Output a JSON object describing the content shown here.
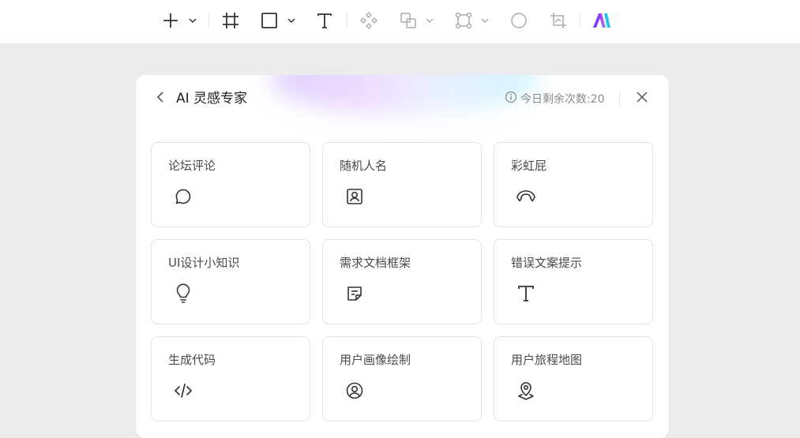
{
  "toolbar": {
    "icons": [
      "plus-icon",
      "chevron-down-icon",
      "frame-icon",
      "rectangle-icon",
      "chevron-down-icon",
      "text-icon",
      "component-icon",
      "boolean-icon",
      "chevron-down-icon",
      "path-icon",
      "chevron-down-icon",
      "circle-icon",
      "crop-icon",
      "ai-logo-icon"
    ]
  },
  "panel": {
    "title": "AI 灵感专家",
    "remaining": "今日剩余次数:20",
    "cards": [
      {
        "label": "论坛评论",
        "icon": "chat-bubble-icon"
      },
      {
        "label": "随机人名",
        "icon": "id-card-icon"
      },
      {
        "label": "彩虹屁",
        "icon": "rainbow-icon"
      },
      {
        "label": "UI设计小知识",
        "icon": "lightbulb-icon"
      },
      {
        "label": "需求文档框架",
        "icon": "sticky-note-icon"
      },
      {
        "label": "错误文案提示",
        "icon": "text-icon"
      },
      {
        "label": "生成代码",
        "icon": "code-icon"
      },
      {
        "label": "用户画像绘制",
        "icon": "user-circle-icon"
      },
      {
        "label": "用户旅程地图",
        "icon": "map-pin-icon"
      }
    ]
  },
  "colors": {
    "accent_purple": "#7b3cff",
    "accent_cyan": "#22c7e6",
    "icon_dark": "#333333",
    "icon_muted": "#8c8c8c"
  }
}
